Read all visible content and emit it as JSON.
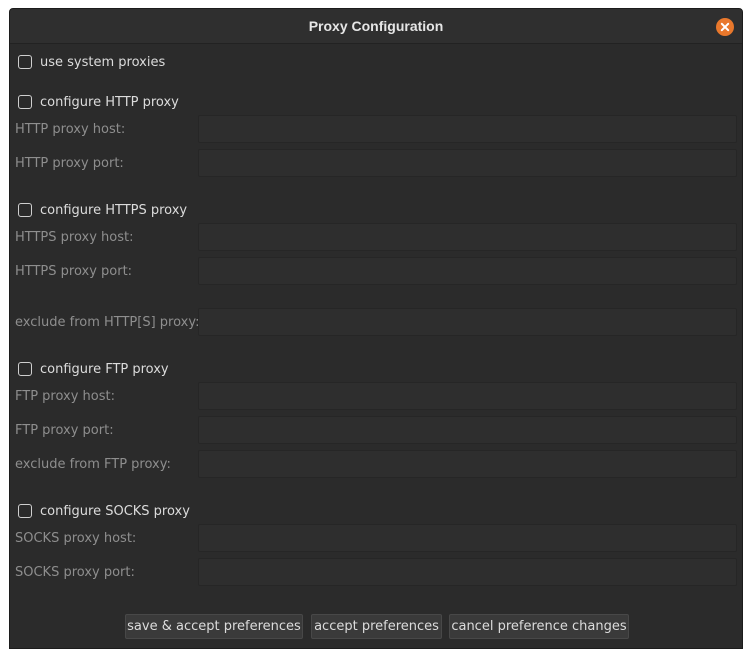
{
  "window": {
    "title": "Proxy Configuration"
  },
  "system": {
    "label": "use system proxies"
  },
  "http": {
    "checkbox_label": "configure HTTP proxy",
    "host_label": "HTTP proxy host:",
    "port_label": "HTTP proxy port:",
    "host_value": "",
    "port_value": ""
  },
  "https": {
    "checkbox_label": "configure HTTPS proxy",
    "host_label": "HTTPS proxy host:",
    "port_label": "HTTPS proxy port:",
    "exclude_label": "exclude from HTTP[S] proxy:",
    "host_value": "",
    "port_value": "",
    "exclude_value": ""
  },
  "ftp": {
    "checkbox_label": "configure FTP proxy",
    "host_label": "FTP proxy host:",
    "port_label": "FTP proxy port:",
    "exclude_label": "exclude from FTP proxy:",
    "host_value": "",
    "port_value": "",
    "exclude_value": ""
  },
  "socks": {
    "checkbox_label": "configure SOCKS proxy",
    "host_label": "SOCKS proxy host:",
    "port_label": "SOCKS proxy port:",
    "host_value": "",
    "port_value": ""
  },
  "buttons": {
    "save_accept": "save & accept preferences",
    "accept": "accept preferences",
    "cancel": "cancel preference changes"
  },
  "colors": {
    "accent_close": "#e9782c",
    "background": "#2b2b2b"
  },
  "icons": {
    "close": "close-icon"
  }
}
